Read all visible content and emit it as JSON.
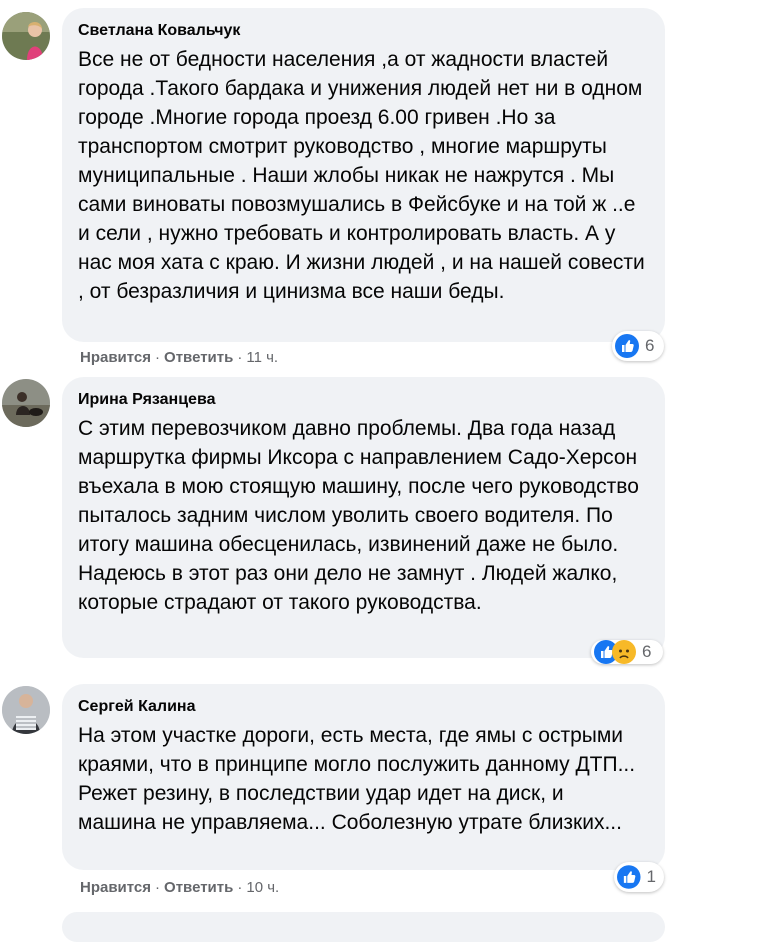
{
  "comments": [
    {
      "author": "Светлана Ковальчук",
      "text": "Все не от бедности населения ,а от жадности властей города .Такого бардака и унижения людей нет ни в одном городе .Многие города проезд 6.00 гривен .Но за транспортом смотрит руководство , многие маршруты муниципальные . Наши жлобы никак не нажрутся . Мы сами виноваты повозмушались в Фейсбуке и на той ж ..е и сели , нужно требовать и контролировать власть. А у нас моя хата с краю. И жизни людей , и на нашей совести , от безразличия и цинизма все наши беды.",
      "like_label": "Нравится",
      "reply_label": "Ответить",
      "time": "11 ч.",
      "reaction_count": "6",
      "reaction_icons": [
        "like-icon"
      ]
    },
    {
      "author": "Ирина Рязанцева",
      "text": "С этим перевозчиком давно проблемы. Два года назад маршрутка фирмы Иксора с направлением Садо-Херсон въехала в мою стоящую машину, после чего руководство пыталось задним числом уволить своего водителя. По итогу машина обесценилась, извинений даже не было. Надеюсь в этот раз они дело не замнут . Людей жалко, которые страдают от такого руководства.",
      "reaction_count": "6",
      "reaction_icons": [
        "like-icon",
        "sad-icon"
      ]
    },
    {
      "author": "Сергей Калина",
      "text": "На этом участке дороги, есть места, где ямы с острыми краями, что в принципе могло послужить данному ДТП... Режет резину, в последствии удар идет на диск, и машина не управляема... Соболезную утрате близких...",
      "like_label": "Нравится",
      "reply_label": "Ответить",
      "time": "10 ч.",
      "reaction_count": "1",
      "reaction_icons": [
        "like-icon"
      ]
    }
  ],
  "colors": {
    "bubble": "#f0f2f5",
    "meta_text": "#65676b",
    "like_blue": "#1877f2",
    "sad_yellow": "#f7b928"
  }
}
